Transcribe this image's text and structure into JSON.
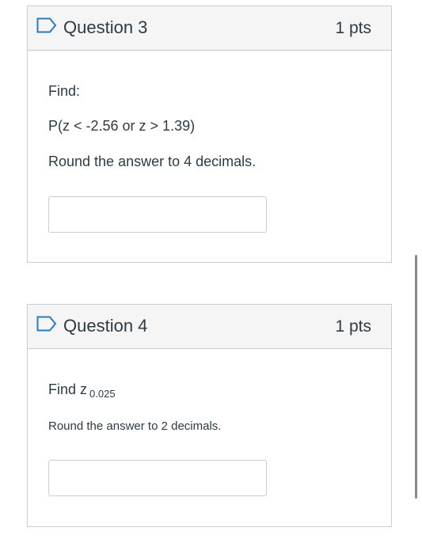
{
  "questions": [
    {
      "title": "Question 3",
      "points": "1 pts",
      "lines": [
        "Find:",
        "P(z < -2.56 or z > 1.39)",
        "Round the answer to 4 decimals."
      ],
      "answer_value": ""
    },
    {
      "title": "Question 4",
      "points": "1 pts",
      "find_prefix": "Find z",
      "find_subscript": "0.025",
      "instruction": "Round the answer to 2 decimals.",
      "answer_value": ""
    }
  ],
  "icons": {
    "flag": "flag-outline-icon"
  },
  "colors": {
    "flag_blue": "#2b7abc",
    "header_bg": "#f5f5f5",
    "border": "#c7cdd1",
    "text": "#2d3b45"
  }
}
